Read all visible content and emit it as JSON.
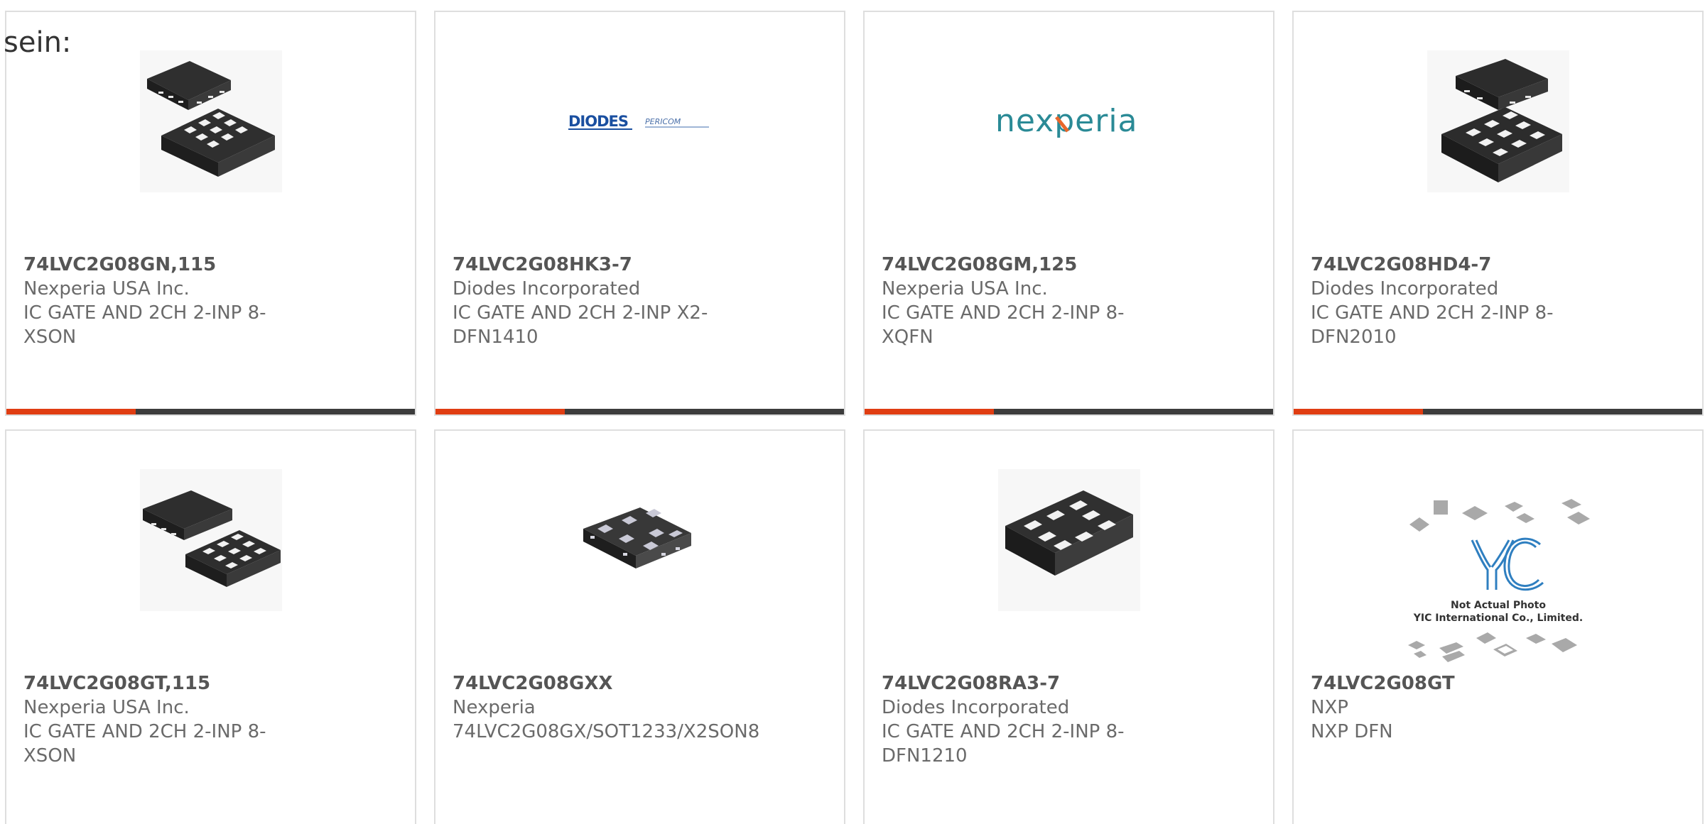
{
  "heading": "sein:",
  "colors": {
    "card_border": "#dedede",
    "bar_accent": "#e03d12",
    "bar_track": "#3c3c3c",
    "text_muted": "#6a6a6a"
  },
  "products": [
    {
      "part_number": "74LVC2G08GN,115",
      "manufacturer": "Nexperia USA Inc.",
      "description": "IC GATE AND 2CH 2-INP 8-XSON",
      "image": "xson8-package-photo"
    },
    {
      "part_number": "74LVC2G08HK3-7",
      "manufacturer": "Diodes Incorporated",
      "description": "IC GATE AND 2CH 2-INP X2-DFN1410",
      "image": "diodes-pericom-logo",
      "logo_text": "DIODES",
      "logo_text_2": "PERICOM"
    },
    {
      "part_number": "74LVC2G08GM,125",
      "manufacturer": "Nexperia USA Inc.",
      "description": "IC GATE AND 2CH 2-INP 8-XQFN",
      "image": "nexperia-logo",
      "logo_text": "nexperia"
    },
    {
      "part_number": "74LVC2G08HD4-7",
      "manufacturer": "Diodes Incorporated",
      "description": "IC GATE AND 2CH 2-INP 8-DFN2010",
      "image": "dfn2010-package-photo"
    },
    {
      "part_number": "74LVC2G08GT,115",
      "manufacturer": "Nexperia USA Inc.",
      "description": "IC GATE AND 2CH 2-INP 8-XSON",
      "image": "xson8-package-photo"
    },
    {
      "part_number": "74LVC2G08GXX",
      "manufacturer": "Nexperia",
      "description": "74LVC2G08GX/SOT1233/X2SON8",
      "image": "x2son8-package-photo"
    },
    {
      "part_number": "74LVC2G08RA3-7",
      "manufacturer": "Diodes Incorporated",
      "description": "IC GATE AND 2CH 2-INP 8-DFN1210",
      "image": "dfn1210-package-photo"
    },
    {
      "part_number": "74LVC2G08GT",
      "manufacturer": "NXP",
      "description": "NXP DFN",
      "image": "yic-placeholder-photo",
      "placeholder_line_1": "Not Actual Photo",
      "placeholder_line_2": "YIC International Co., Limited."
    }
  ]
}
